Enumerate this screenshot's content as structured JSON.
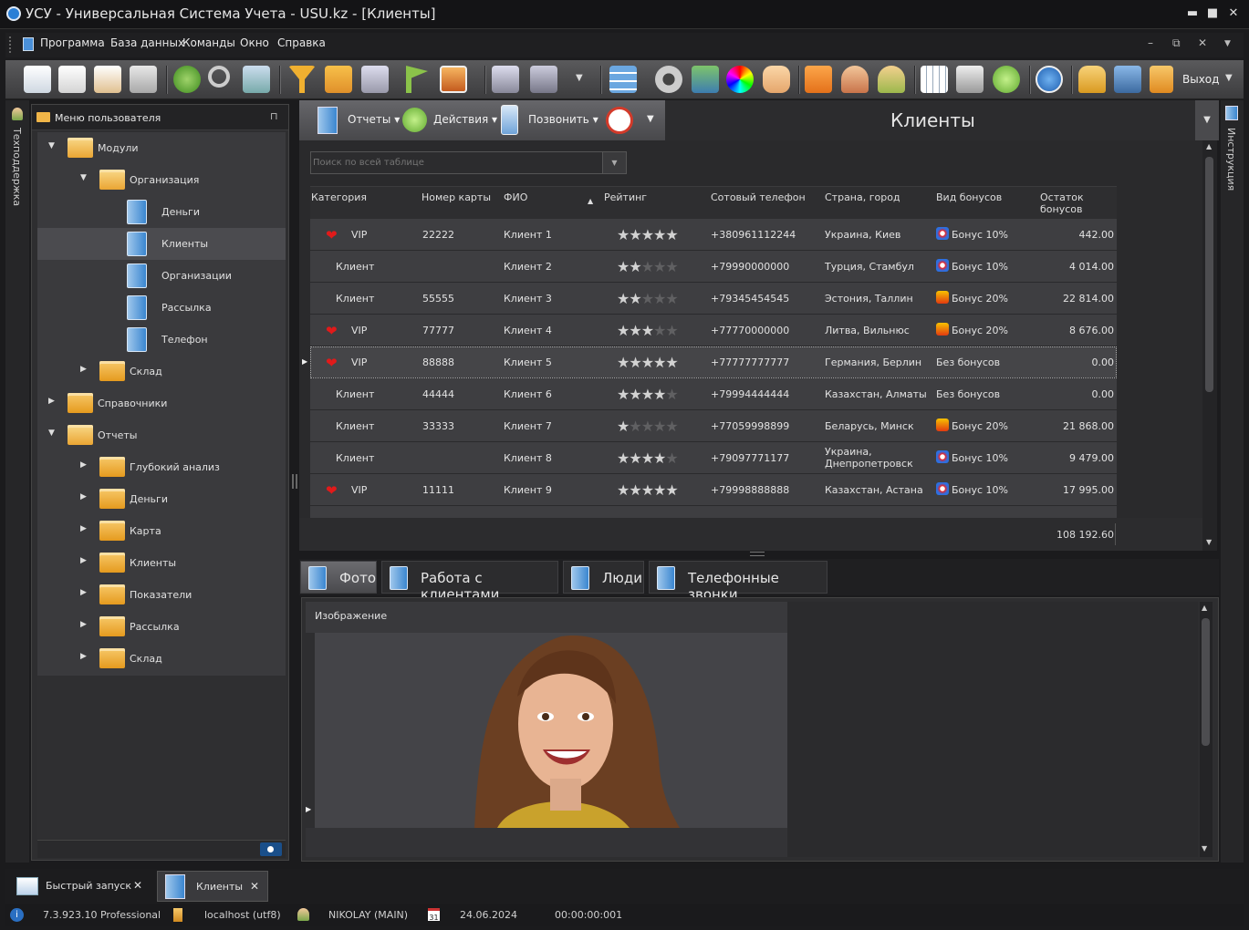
{
  "window": {
    "title": "УСУ - Универсальная Система Учета - USU.kz - [Клиенты]",
    "min": "▬",
    "max": "■",
    "close": "✕"
  },
  "menu": {
    "items": [
      "Программа",
      "База данных",
      "Команды",
      "Окно",
      "Справка"
    ],
    "win_min": "–",
    "win_restore": "⧉",
    "win_close": "✕",
    "win_dd": "▼"
  },
  "toolbar": {
    "exit_label": "Выход"
  },
  "left_strip": {
    "label": "Техподдержка"
  },
  "right_strip": {
    "label": "Инструкция"
  },
  "user_menu": {
    "title": "Меню пользователя",
    "pin": "⊓",
    "items": [
      {
        "label": "Модули",
        "level": 0,
        "icon": "folder-open",
        "expander": "▼"
      },
      {
        "label": "Организация",
        "level": 1,
        "icon": "folder-open",
        "expander": "▼"
      },
      {
        "label": "Деньги",
        "level": 2,
        "icon": "book",
        "expander": ""
      },
      {
        "label": "Клиенты",
        "level": 2,
        "icon": "book",
        "expander": "",
        "selected": true
      },
      {
        "label": "Организации",
        "level": 2,
        "icon": "book",
        "expander": ""
      },
      {
        "label": "Рассылка",
        "level": 2,
        "icon": "book",
        "expander": ""
      },
      {
        "label": "Телефон",
        "level": 2,
        "icon": "book",
        "expander": ""
      },
      {
        "label": "Склад",
        "level": 1,
        "icon": "folder",
        "expander": "▶"
      },
      {
        "label": "Справочники",
        "level": 0,
        "icon": "folder",
        "expander": "▶"
      },
      {
        "label": "Отчеты",
        "level": 0,
        "icon": "folder-open",
        "expander": "▼"
      },
      {
        "label": "Глубокий анализ",
        "level": 1,
        "icon": "folder",
        "expander": "▶"
      },
      {
        "label": "Деньги",
        "level": 1,
        "icon": "folder",
        "expander": "▶"
      },
      {
        "label": "Карта",
        "level": 1,
        "icon": "folder",
        "expander": "▶"
      },
      {
        "label": "Клиенты",
        "level": 1,
        "icon": "folder",
        "expander": "▶"
      },
      {
        "label": "Показатели",
        "level": 1,
        "icon": "folder",
        "expander": "▶"
      },
      {
        "label": "Рассылка",
        "level": 1,
        "icon": "folder",
        "expander": "▶"
      },
      {
        "label": "Склад",
        "level": 1,
        "icon": "folder",
        "expander": "▶"
      }
    ]
  },
  "main": {
    "title": "Клиенты",
    "reports": "Отчеты",
    "actions": "Действия",
    "call": "Позвонить",
    "search_placeholder": "Поиск по всей таблице",
    "columns": [
      "Категория",
      "Номер карты",
      "ФИО",
      "Рейтинг",
      "Сотовый телефон",
      "Страна, город",
      "Вид бонусов",
      "Остаток бонусов"
    ],
    "rows": [
      {
        "vip": true,
        "category": "VIP",
        "card": "22222",
        "name": "Клиент 1",
        "rating": 5,
        "phone": "+380961112244",
        "city": "Украина, Киев",
        "bonus": "Бонус 10%",
        "bonus_icon": "b10",
        "balance": "442.00"
      },
      {
        "vip": false,
        "category": "Клиент",
        "card": "",
        "name": "Клиент 2",
        "rating": 2,
        "phone": "+79990000000",
        "city": "Турция, Стамбул",
        "bonus": "Бонус 10%",
        "bonus_icon": "b10",
        "balance": "4 014.00"
      },
      {
        "vip": false,
        "category": "Клиент",
        "card": "55555",
        "name": "Клиент 3",
        "rating": 2,
        "phone": "+79345454545",
        "city": "Эстония, Таллин",
        "bonus": "Бонус 20%",
        "bonus_icon": "b20",
        "balance": "22 814.00"
      },
      {
        "vip": true,
        "category": "VIP",
        "card": "77777",
        "name": "Клиент 4",
        "rating": 3,
        "phone": "+77770000000",
        "city": "Литва, Вильнюс",
        "bonus": "Бонус 20%",
        "bonus_icon": "b20",
        "balance": "8 676.00"
      },
      {
        "vip": true,
        "category": "VIP",
        "card": "88888",
        "name": "Клиент 5",
        "rating": 5,
        "phone": "+77777777777",
        "city": "Германия, Берлин",
        "bonus": "Без бонусов",
        "bonus_icon": "",
        "balance": "0.00",
        "selected": true
      },
      {
        "vip": false,
        "category": "Клиент",
        "card": "44444",
        "name": "Клиент 6",
        "rating": 4,
        "phone": "+79994444444",
        "city": "Казахстан, Алматы",
        "bonus": "Без бонусов",
        "bonus_icon": "",
        "balance": "0.00"
      },
      {
        "vip": false,
        "category": "Клиент",
        "card": "33333",
        "name": "Клиент 7",
        "rating": 1,
        "phone": "+77059998899",
        "city": "Беларусь, Минск",
        "bonus": "Бонус 20%",
        "bonus_icon": "b20",
        "balance": "21 868.00"
      },
      {
        "vip": false,
        "category": "Клиент",
        "card": "",
        "name": "Клиент 8",
        "rating": 4,
        "phone": "+79097771177",
        "city": "Украина,\nДнепропетровск",
        "bonus": "Бонус 10%",
        "bonus_icon": "b10",
        "balance": "9 479.00"
      },
      {
        "vip": true,
        "category": "VIP",
        "card": "11111",
        "name": "Клиент 9",
        "rating": 5,
        "phone": "+79998888888",
        "city": "Казахстан, Астана",
        "bonus": "Бонус 10%",
        "bonus_icon": "b10",
        "balance": "17 995.00"
      }
    ],
    "total": "108 192.60"
  },
  "bottom_tabs": [
    "Фото",
    "Работа с клиентами",
    "Люди",
    "Телефонные звонки"
  ],
  "photo": {
    "label": "Изображение"
  },
  "task_tabs": [
    {
      "label": "Быстрый запуск",
      "close": "✕"
    },
    {
      "label": "Клиенты",
      "close": "✕"
    }
  ],
  "status": {
    "version": "7.3.923.10 Professional",
    "db": "localhost (utf8)",
    "user": "NIKOLAY (MAIN)",
    "date": "24.06.2024",
    "timer": "00:00:00:001",
    "cal_day": "31"
  },
  "colors": {
    "vip_heart": "#e11a1a",
    "folder": "#f0b548",
    "book": "#4a90d9"
  }
}
